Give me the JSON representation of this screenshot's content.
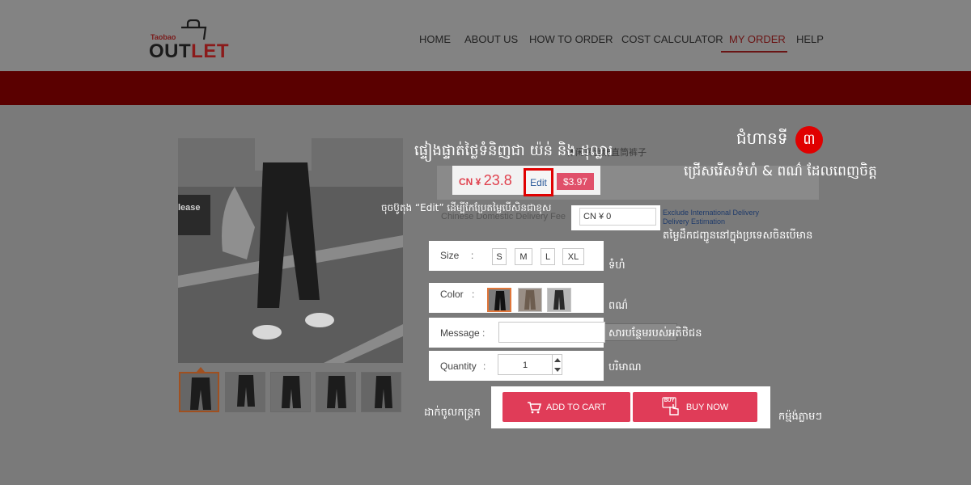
{
  "brand": {
    "top": "Taobao",
    "main_start": "OUT",
    "main_accent": "LET"
  },
  "nav": {
    "items": [
      {
        "label": "HOME"
      },
      {
        "label": "ABOUT US"
      },
      {
        "label": "HOW TO ORDER"
      },
      {
        "label": "COST CALCULATOR"
      },
      {
        "label": "MY ORDER",
        "active": true
      },
      {
        "label": "HELP"
      }
    ]
  },
  "product": {
    "title_fragment": "休闲裤雪纺直筒裤子",
    "main_image_text": "lease",
    "price": {
      "currency": "CN ¥",
      "value": "23.8",
      "usd": "$3.97"
    },
    "edit_label": "Edit",
    "domestic_label": "Chinese Domestic Delivery Fee",
    "shipping_value": "CN ¥ 0",
    "shipping_note": [
      "Exclude International Delivery",
      "Delivery Estimation"
    ],
    "size": {
      "label": "Size",
      "colon": ":",
      "options": [
        "S",
        "M",
        "L",
        "XL"
      ]
    },
    "color": {
      "label": "Color",
      "colon": ":"
    },
    "message": {
      "label": "Message",
      "colon": ":",
      "value": ""
    },
    "quantity": {
      "label": "Quantity",
      "colon": ":",
      "value": "1"
    },
    "add_to_cart": "ADD TO CART",
    "buy_now": "BUY NOW",
    "buy_icon_text": "BUY"
  },
  "annotations": {
    "title": "ផ្ទៀងផ្ទាត់ថ្លៃទំនិញជា យ៉ន់ និង ដុល្លារ",
    "edit_hint": "ចុចប៊ូតុង “Edit” ដើម្បីកែប្រែតម្លៃបើសិនជាខុស",
    "ship_hint": "តម្លៃដឹកជញ្ជូននៅក្នុងប្រទេសចិនបើមាន",
    "size": "ទំហំ",
    "color": "ពណ៌",
    "message": "សារបន្ថែមរបស់អតិថិជន",
    "quantity": "បរិមាណ",
    "cart": "ដាក់ចូលកន្ត្រក",
    "buy": "កម្ម៉ង់ភ្លាមៗ",
    "step": "ជំហានទី",
    "step_number": "៣",
    "step_sub": "ជ្រើសរើសទំហំ & ពណ៌ ដែលពេញចិត្ត"
  },
  "colors": {
    "accent_red": "#e03c58",
    "band": "#5a0000",
    "highlight": "#e00000"
  },
  "icons": [
    "shopping-bag-icon",
    "cart-icon",
    "buy-hand-icon",
    "chevron-up-icon",
    "chevron-down-icon"
  ]
}
